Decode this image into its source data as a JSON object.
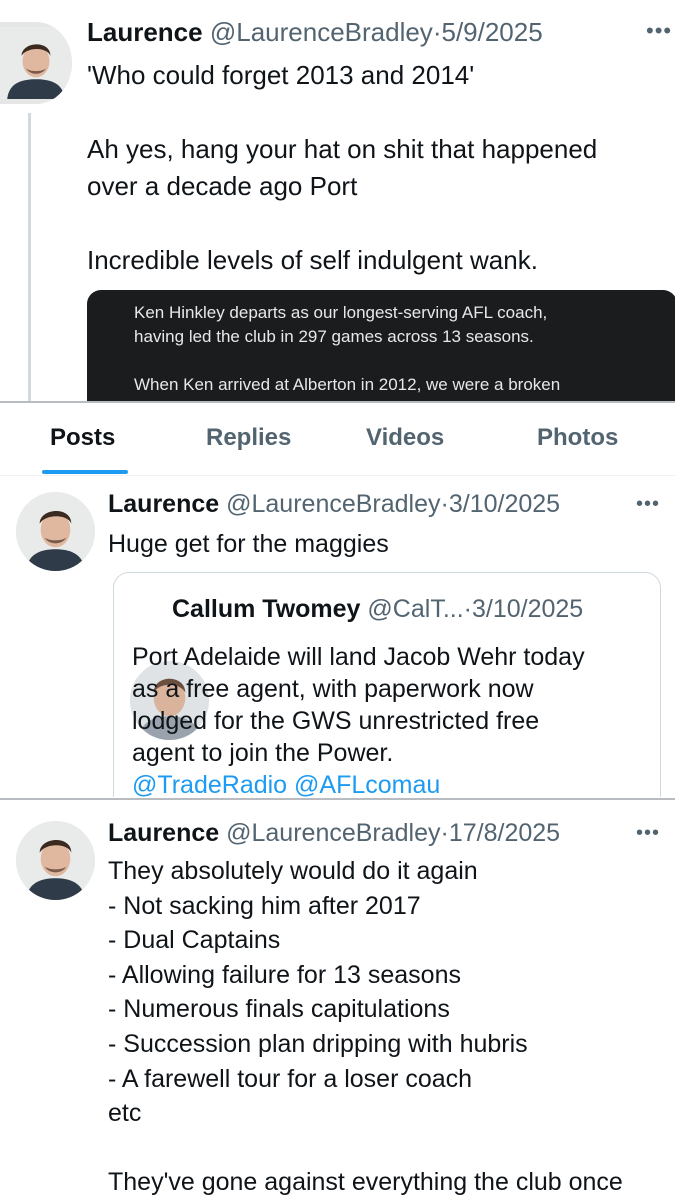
{
  "post1": {
    "name": "Laurence",
    "handle": "@LaurenceBradley",
    "separator": "·",
    "date": "5/9/2025",
    "more": "•••",
    "lines": [
      "'Who could forget 2013 and 2014'",
      "",
      "Ah yes, hang your hat on shit that happened",
      "over a decade ago Port",
      "",
      "Incredible levels of self indulgent wank."
    ],
    "media_lines": [
      "Ken Hinkley departs as our longest-serving AFL coach,",
      "having led the club in 297 games across 13 seasons.",
      "",
      "When Ken arrived at Alberton in 2012, we were a broken"
    ]
  },
  "tabs": [
    {
      "label": "Posts",
      "active": true
    },
    {
      "label": "Replies",
      "active": false
    },
    {
      "label": "Videos",
      "active": false
    },
    {
      "label": "Photos",
      "active": false
    }
  ],
  "post2": {
    "name": "Laurence",
    "handle": "@LaurenceBradley",
    "separator": "·",
    "date": "3/10/2025",
    "more": "•••",
    "text": "Huge get for the maggies",
    "quote": {
      "name": "Callum Twomey",
      "handle": "@CalT...",
      "separator": "·",
      "date": "3/10/2025",
      "lines": [
        "Port Adelaide will land Jacob Wehr today",
        "as a free agent, with paperwork now",
        "lodged for the GWS unrestricted free",
        "agent to join the Power."
      ],
      "links": "@TradeRadio @AFLcomau"
    }
  },
  "post3": {
    "name": "Laurence",
    "handle": "@LaurenceBradley",
    "separator": "·",
    "date": "17/8/2025",
    "more": "•••",
    "lines": [
      "They absolutely would do it again",
      "- Not sacking him after 2017",
      "- Dual Captains",
      "- Allowing failure for 13 seasons",
      "- Numerous finals capitulations",
      "- Succession plan dripping with hubris",
      "- A farewell tour for a loser coach",
      "etc",
      "",
      "They've gone against everything the club once"
    ]
  },
  "colors": {
    "accent": "#1d9bf0",
    "text": "#0f1419",
    "secondary": "#536471",
    "media_bg": "#1b1c1e"
  },
  "icons": {
    "avatar": "profile-photo-avatar",
    "more": "more-options-icon"
  }
}
